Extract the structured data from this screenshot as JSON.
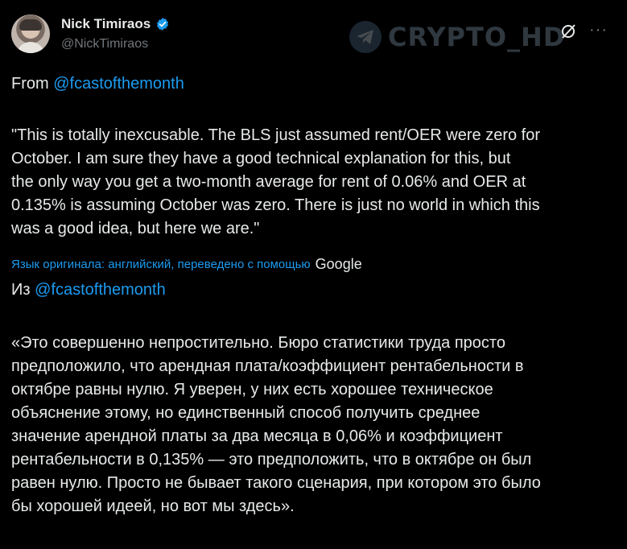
{
  "author": {
    "name": "Nick Timiraos",
    "handle": "@NickTimiraos"
  },
  "watermark": {
    "text": "CRYPTO_HD"
  },
  "actions": {
    "grok_icon": "grok-icon",
    "more_label": "···"
  },
  "tweet": {
    "from_prefix": "From ",
    "from_mention": "@fcastofthemonth",
    "quote_lines": [
      "\"This is totally inexcusable. The BLS just assumed rent/OER were zero for",
      "October. I am sure they have a good technical explanation for this, but",
      "the only way you get a two-month average for rent of 0.06% and OER at",
      "0.135% is assuming October was zero. There is just no world in which this",
      "was a good idea, but here we are.\""
    ],
    "translation_note": "Язык оригинала: английский, переведено с помощью",
    "translation_provider": "Google",
    "ru_from_prefix": "Из ",
    "ru_from_mention": "@fcastofthemonth",
    "ru_quote_lines": [
      "«Это совершенно непростительно. Бюро статистики труда просто",
      "предположило, что арендная плата/коэффициент рентабельности в",
      "октябре равны нулю. Я уверен, у них есть хорошее техническое",
      "объяснение этому, но единственный способ получить среднее",
      "значение арендной платы за два месяца в 0,06% и коэффициент",
      "рентабельности в 0,135% — это предположить, что в октябре он был",
      "равен нулю. Просто не бывает такого сценария, при котором это было",
      "бы хорошей идеей, но вот мы здесь»."
    ]
  },
  "colors": {
    "background": "#000000",
    "text": "#e7e9ea",
    "secondary": "#71767b",
    "link": "#1d9bf0"
  }
}
